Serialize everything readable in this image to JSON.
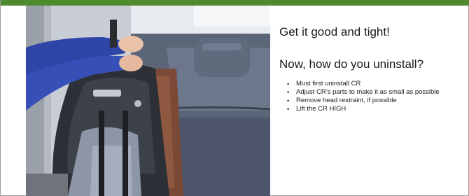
{
  "slide": {
    "accent_color": "#4f8a2f",
    "title_primary": "Get it good and tight!",
    "title_secondary": "Now, how do you uninstall?",
    "bullets": [
      "Must first uninstall CR",
      "Adjust CR’s parts to make it as small as possible",
      "Remove head restraint, if possible",
      "Lift the CR HIGH"
    ],
    "bullet_glyph": "•"
  }
}
